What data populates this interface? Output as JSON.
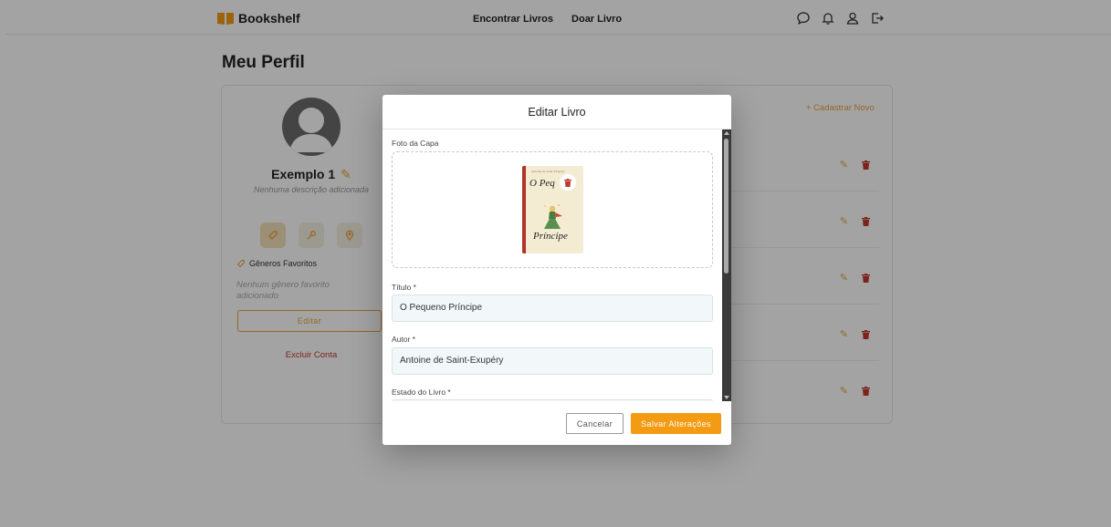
{
  "navbar": {
    "brand": "Bookshelf",
    "links": [
      "Encontrar Livros",
      "Doar Livro"
    ],
    "icons": [
      "chat-icon",
      "bell-icon",
      "user-icon",
      "logout-icon"
    ]
  },
  "page": {
    "title": "Meu Perfil"
  },
  "profile": {
    "name": "Exemplo 1",
    "description": "Nenhuma descrição adicionada",
    "genres_label": "Gêneros Favoritos",
    "genres_empty": "Nenhum gênero favorito adicionado",
    "edit_button": "Editar",
    "delete_account": "Excluir Conta"
  },
  "books_panel": {
    "register_new": "+ Cadastrar Novo",
    "row_count": 5
  },
  "modal": {
    "title": "Editar Livro",
    "cover_label": "Foto da Capa",
    "cover_text": {
      "author": "Antoine de Saint-Exupéry",
      "title_line_1": "O Peq",
      "title_line_2": "Príncipe"
    },
    "fields": {
      "title": {
        "label": "Título *",
        "value": "O Pequeno Príncipe"
      },
      "author": {
        "label": "Autor *",
        "value": "Antoine de Saint-Exupéry"
      },
      "condition": {
        "label": "Estado do Livro *",
        "value": ""
      }
    },
    "cancel_button": "Cancelar",
    "save_button": "Salvar Alterações"
  },
  "colors": {
    "accent": "#f39b12",
    "danger": "#c0392b",
    "overlay": "rgba(0,0,0,0.36)"
  }
}
